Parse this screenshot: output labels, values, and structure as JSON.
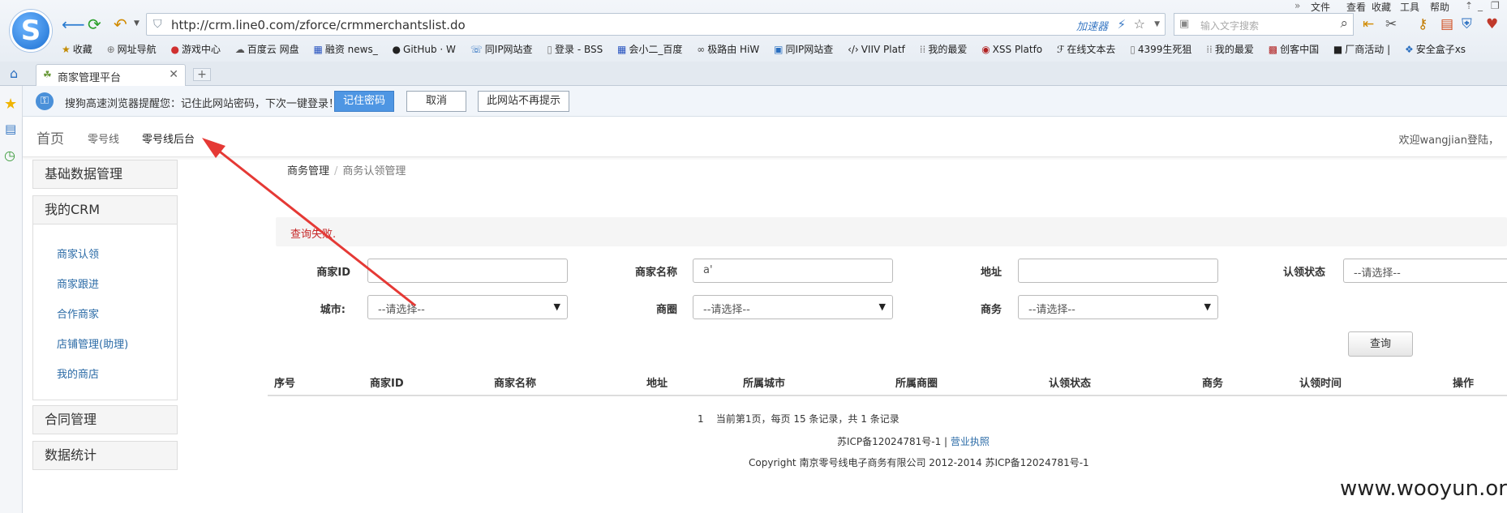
{
  "browser": {
    "address": "http://crm.line0.com/zforce/crmmerchantslist.do",
    "accelerator": "加速器",
    "search_placeholder": "输入文字搜索",
    "menu": [
      "文件",
      "查看",
      "收藏",
      "工具",
      "帮助"
    ],
    "favorites": [
      "收藏",
      "网址导航",
      "游戏中心",
      "百度云 网盘",
      "融资 news_",
      "GitHub · W",
      "同IP网站查",
      "登录 - BSS",
      "会小二_百度",
      "极路由 HiW",
      "同IP网站查",
      "VIIV Platf",
      "我的最爱",
      "XSS Platfo",
      "在线文本去",
      "4399生死狙",
      "我的最爱",
      "创客中国",
      "厂商活动 |",
      "安全盒子xs"
    ],
    "tab_title": "商家管理平台",
    "new_tab": "+"
  },
  "notify": {
    "text": "搜狗高速浏览器提醒您：记住此网站密码，下次一键登录！",
    "remember": "记住密码",
    "cancel": "取消",
    "never": "此网站不再提示"
  },
  "nav": {
    "home": "首页",
    "lingx": "零号线",
    "admin": "零号线后台",
    "welcome": "欢迎wangjian登陆，"
  },
  "left_menu": {
    "basic": "基础数据管理",
    "my_crm": "我的CRM",
    "items": [
      "商家认领",
      "商家跟进",
      "合作商家",
      "店铺管理(助理)",
      "我的商店"
    ],
    "contract": "合同管理",
    "stats": "数据统计"
  },
  "breadcrumb": {
    "root": "商务管理",
    "sep": "/",
    "current": "商务认领管理"
  },
  "error": "查询失败.",
  "form": {
    "merchant_id_label": "商家ID",
    "merchant_id_value": "",
    "merchant_name_label": "商家名称",
    "merchant_name_value": "a'",
    "address_label": "地址",
    "address_value": "",
    "claim_status_label": "认领状态",
    "claim_status_value": "--请选择--",
    "city_label": "城市:",
    "city_value": "--请选择--",
    "district_label": "商圈",
    "district_value": "--请选择--",
    "business_label": "商务",
    "business_value": "--请选择--",
    "query_button": "查询"
  },
  "table": {
    "headers": [
      "序号",
      "商家ID",
      "商家名称",
      "地址",
      "所属城市",
      "所属商圈",
      "认领状态",
      "商务",
      "认领时间",
      "操作"
    ]
  },
  "pager": "1    当前第1页，每页 15 条记录，共 1 条记录",
  "footer": {
    "icp": "苏ICP备12024781号-1 |",
    "license": "营业执照",
    "copyright": "Copyright 南京零号线电子商务有限公司 2012-2014 苏ICP备12024781号-1"
  },
  "watermark": "www.wooyun.org",
  "colors": {
    "primary_button": "#4e96e3",
    "error": "#c62828",
    "link": "#2a6aa6",
    "arrow": "#e53935"
  }
}
